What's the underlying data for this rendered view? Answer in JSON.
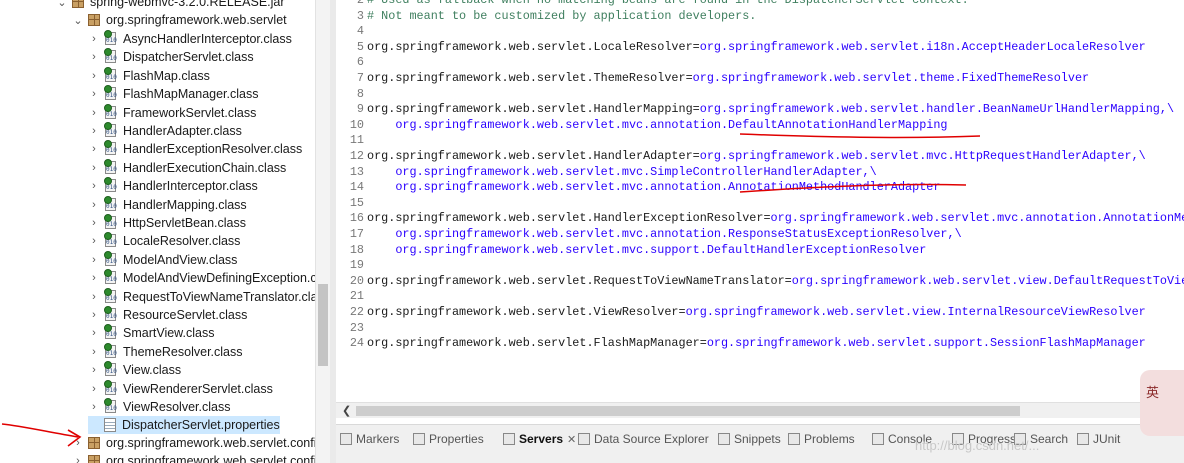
{
  "tree": {
    "top_item": "spring-webmvc-3.2.0.RELEASE.jar",
    "package": "org.springframework.web.servlet",
    "classes": [
      "AsyncHandlerInterceptor.class",
      "DispatcherServlet.class",
      "FlashMap.class",
      "FlashMapManager.class",
      "FrameworkServlet.class",
      "HandlerAdapter.class",
      "HandlerExceptionResolver.class",
      "HandlerExecutionChain.class",
      "HandlerInterceptor.class",
      "HandlerMapping.class",
      "HttpServletBean.class",
      "LocaleResolver.class",
      "ModelAndView.class",
      "ModelAndViewDefiningException.cla",
      "RequestToViewNameTranslator.clas",
      "ResourceServlet.class",
      "SmartView.class",
      "ThemeResolver.class",
      "View.class",
      "ViewRendererServlet.class",
      "ViewResolver.class"
    ],
    "selected_file": "DispatcherServlet.properties",
    "packages_after": [
      "org.springframework.web.servlet.config",
      "org.springframework.web.servlet.config"
    ]
  },
  "editor": {
    "lines": [
      {
        "n": "2",
        "key": "",
        "val": "",
        "comment": "# Used as fallback when no matching beans are found in the DispatcherServlet context."
      },
      {
        "n": "3",
        "key": "",
        "val": "",
        "comment": "# Not meant to be customized by application developers."
      },
      {
        "n": "4",
        "key": "",
        "val": "",
        "comment": ""
      },
      {
        "n": "5",
        "key": "org.springframework.web.servlet.LocaleResolver=",
        "val": "org.springframework.web.servlet.i18n.AcceptHeaderLocaleResolver",
        "comment": ""
      },
      {
        "n": "6",
        "key": "",
        "val": "",
        "comment": ""
      },
      {
        "n": "7",
        "key": "org.springframework.web.servlet.ThemeResolver=",
        "val": "org.springframework.web.servlet.theme.FixedThemeResolver",
        "comment": ""
      },
      {
        "n": "8",
        "key": "",
        "val": "",
        "comment": ""
      },
      {
        "n": "9",
        "key": "org.springframework.web.servlet.HandlerMapping=",
        "val": "org.springframework.web.servlet.handler.BeanNameUrlHandlerMapping,\\",
        "comment": ""
      },
      {
        "n": "10",
        "key": "    ",
        "val": "org.springframework.web.servlet.mvc.annotation.DefaultAnnotationHandlerMapping",
        "comment": ""
      },
      {
        "n": "11",
        "key": "",
        "val": "",
        "comment": ""
      },
      {
        "n": "12",
        "key": "org.springframework.web.servlet.HandlerAdapter=",
        "val": "org.springframework.web.servlet.mvc.HttpRequestHandlerAdapter,\\",
        "comment": ""
      },
      {
        "n": "13",
        "key": "    ",
        "val": "org.springframework.web.servlet.mvc.SimpleControllerHandlerAdapter,\\",
        "comment": ""
      },
      {
        "n": "14",
        "key": "    ",
        "val": "org.springframework.web.servlet.mvc.annotation.AnnotationMethodHandlerAdapter",
        "comment": ""
      },
      {
        "n": "15",
        "key": "",
        "val": "",
        "comment": ""
      },
      {
        "n": "16",
        "key": "org.springframework.web.servlet.HandlerExceptionResolver=",
        "val": "org.springframework.web.servlet.mvc.annotation.AnnotationMethodHandlerExceptionResolver,\\",
        "comment": ""
      },
      {
        "n": "17",
        "key": "    ",
        "val": "org.springframework.web.servlet.mvc.annotation.ResponseStatusExceptionResolver,\\",
        "comment": ""
      },
      {
        "n": "18",
        "key": "    ",
        "val": "org.springframework.web.servlet.mvc.support.DefaultHandlerExceptionResolver",
        "comment": ""
      },
      {
        "n": "19",
        "key": "",
        "val": "",
        "comment": ""
      },
      {
        "n": "20",
        "key": "org.springframework.web.servlet.RequestToViewNameTranslator=",
        "val": "org.springframework.web.servlet.view.DefaultRequestToViewNameTranslator",
        "comment": ""
      },
      {
        "n": "21",
        "key": "",
        "val": "",
        "comment": ""
      },
      {
        "n": "22",
        "key": "org.springframework.web.servlet.ViewResolver=",
        "val": "org.springframework.web.servlet.view.InternalResourceViewResolver",
        "comment": ""
      },
      {
        "n": "23",
        "key": "",
        "val": "",
        "comment": ""
      },
      {
        "n": "24",
        "key": "org.springframework.web.servlet.FlashMapManager=",
        "val": "org.springframework.web.servlet.support.SessionFlashMapManager",
        "comment": ""
      }
    ]
  },
  "bottom_tabs": [
    {
      "label": "Markers",
      "icon": "markers-icon",
      "active": false
    },
    {
      "label": "Properties",
      "icon": "properties-icon",
      "active": false
    },
    {
      "label": "Servers",
      "icon": "servers-icon",
      "active": true
    },
    {
      "label": "Data Source Explorer",
      "icon": "data-source-icon",
      "active": false
    },
    {
      "label": "Snippets",
      "icon": "snippets-icon",
      "active": false
    },
    {
      "label": "Problems",
      "icon": "problems-icon",
      "active": false
    },
    {
      "label": "Console",
      "icon": "console-icon",
      "active": false
    },
    {
      "label": "Progress",
      "icon": "progress-icon",
      "active": false
    },
    {
      "label": "Search",
      "icon": "search-icon",
      "active": false
    },
    {
      "label": "JUnit",
      "icon": "junit-icon",
      "active": false
    }
  ],
  "ime": {
    "label": "英"
  },
  "watermark": "http://blog.csdn.net/...",
  "colors": {
    "value_blue": "#2a00ff",
    "annotation_red": "#e00000",
    "selection": "#cce8ff"
  }
}
